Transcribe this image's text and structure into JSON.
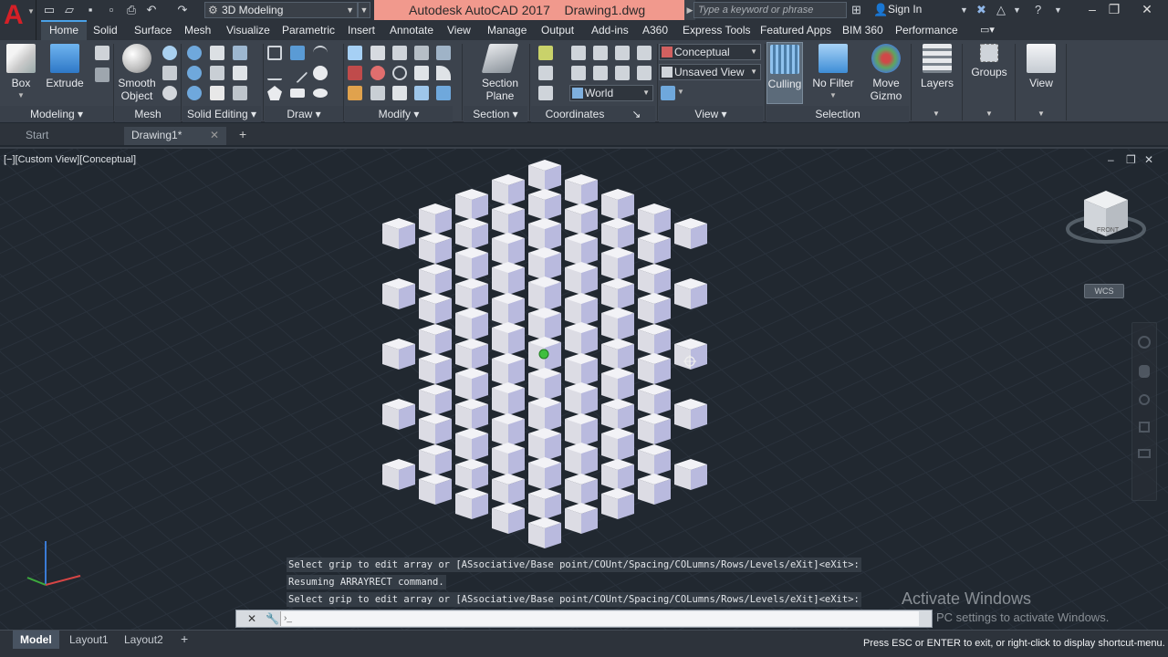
{
  "title_bar": {
    "app_title": "Autodesk AutoCAD 2017",
    "file_name": "Drawing1.dwg",
    "workspace": "3D Modeling",
    "search_placeholder": "Type a keyword or phrase",
    "sign_in": "Sign In"
  },
  "ribbon_tabs": [
    "Home",
    "Solid",
    "Surface",
    "Mesh",
    "Visualize",
    "Parametric",
    "Insert",
    "Annotate",
    "View",
    "Manage",
    "Output",
    "Add-ins",
    "A360",
    "Express Tools",
    "Featured Apps",
    "BIM 360",
    "Performance"
  ],
  "ribbon": {
    "box": "Box",
    "extrude": "Extrude",
    "smooth": [
      "Smooth",
      "Object"
    ],
    "section": [
      "Section",
      "Plane"
    ],
    "visual_style": "Conceptual",
    "view": "Unsaved View",
    "ucs": "World",
    "culling": "Culling",
    "no_filter": "No Filter",
    "move": [
      "Move",
      "Gizmo"
    ],
    "layers": "Layers",
    "groups": "Groups",
    "view_btn": "View",
    "panels": {
      "modeling": "Modeling",
      "mesh": "Mesh",
      "solid_editing": "Solid Editing",
      "draw": "Draw",
      "modify": "Modify",
      "section": "Section",
      "coordinates": "Coordinates",
      "view": "View",
      "selection": "Selection"
    }
  },
  "doc_tabs": {
    "start": "Start",
    "drawing": "Drawing1*"
  },
  "viewport": {
    "label": "[−][Custom View][Conceptual]",
    "wcs": "WCS",
    "viewcube_face": "FRONT"
  },
  "command": {
    "lines": [
      "Select grip to edit array or [ASsociative/Base point/COUnt/Spacing/COLumns/Rows/Levels/eXit]<eXit>:",
      "Resuming ARRAYRECT command.",
      "Select grip to edit array or [ASsociative/Base point/COUnt/Spacing/COLumns/Rows/Levels/eXit]<eXit>:"
    ]
  },
  "watermark": {
    "line1": "Activate Windows",
    "line2": "PC settings to activate Windows."
  },
  "status_bar": {
    "tabs": [
      "Model",
      "Layout1",
      "Layout2"
    ],
    "message": "Press ESC or ENTER to exit, or right-click to display shortcut-menu."
  },
  "colors": {
    "accent": "#4aa1e6",
    "title_bg": "#f1998d",
    "viewport_bg": "#212830",
    "cube_top": "#f2f2f6",
    "cube_left": "#dcdce4",
    "cube_right": "#b9bade"
  },
  "array": {
    "columns": 5,
    "rows": 5,
    "levels": 5
  }
}
